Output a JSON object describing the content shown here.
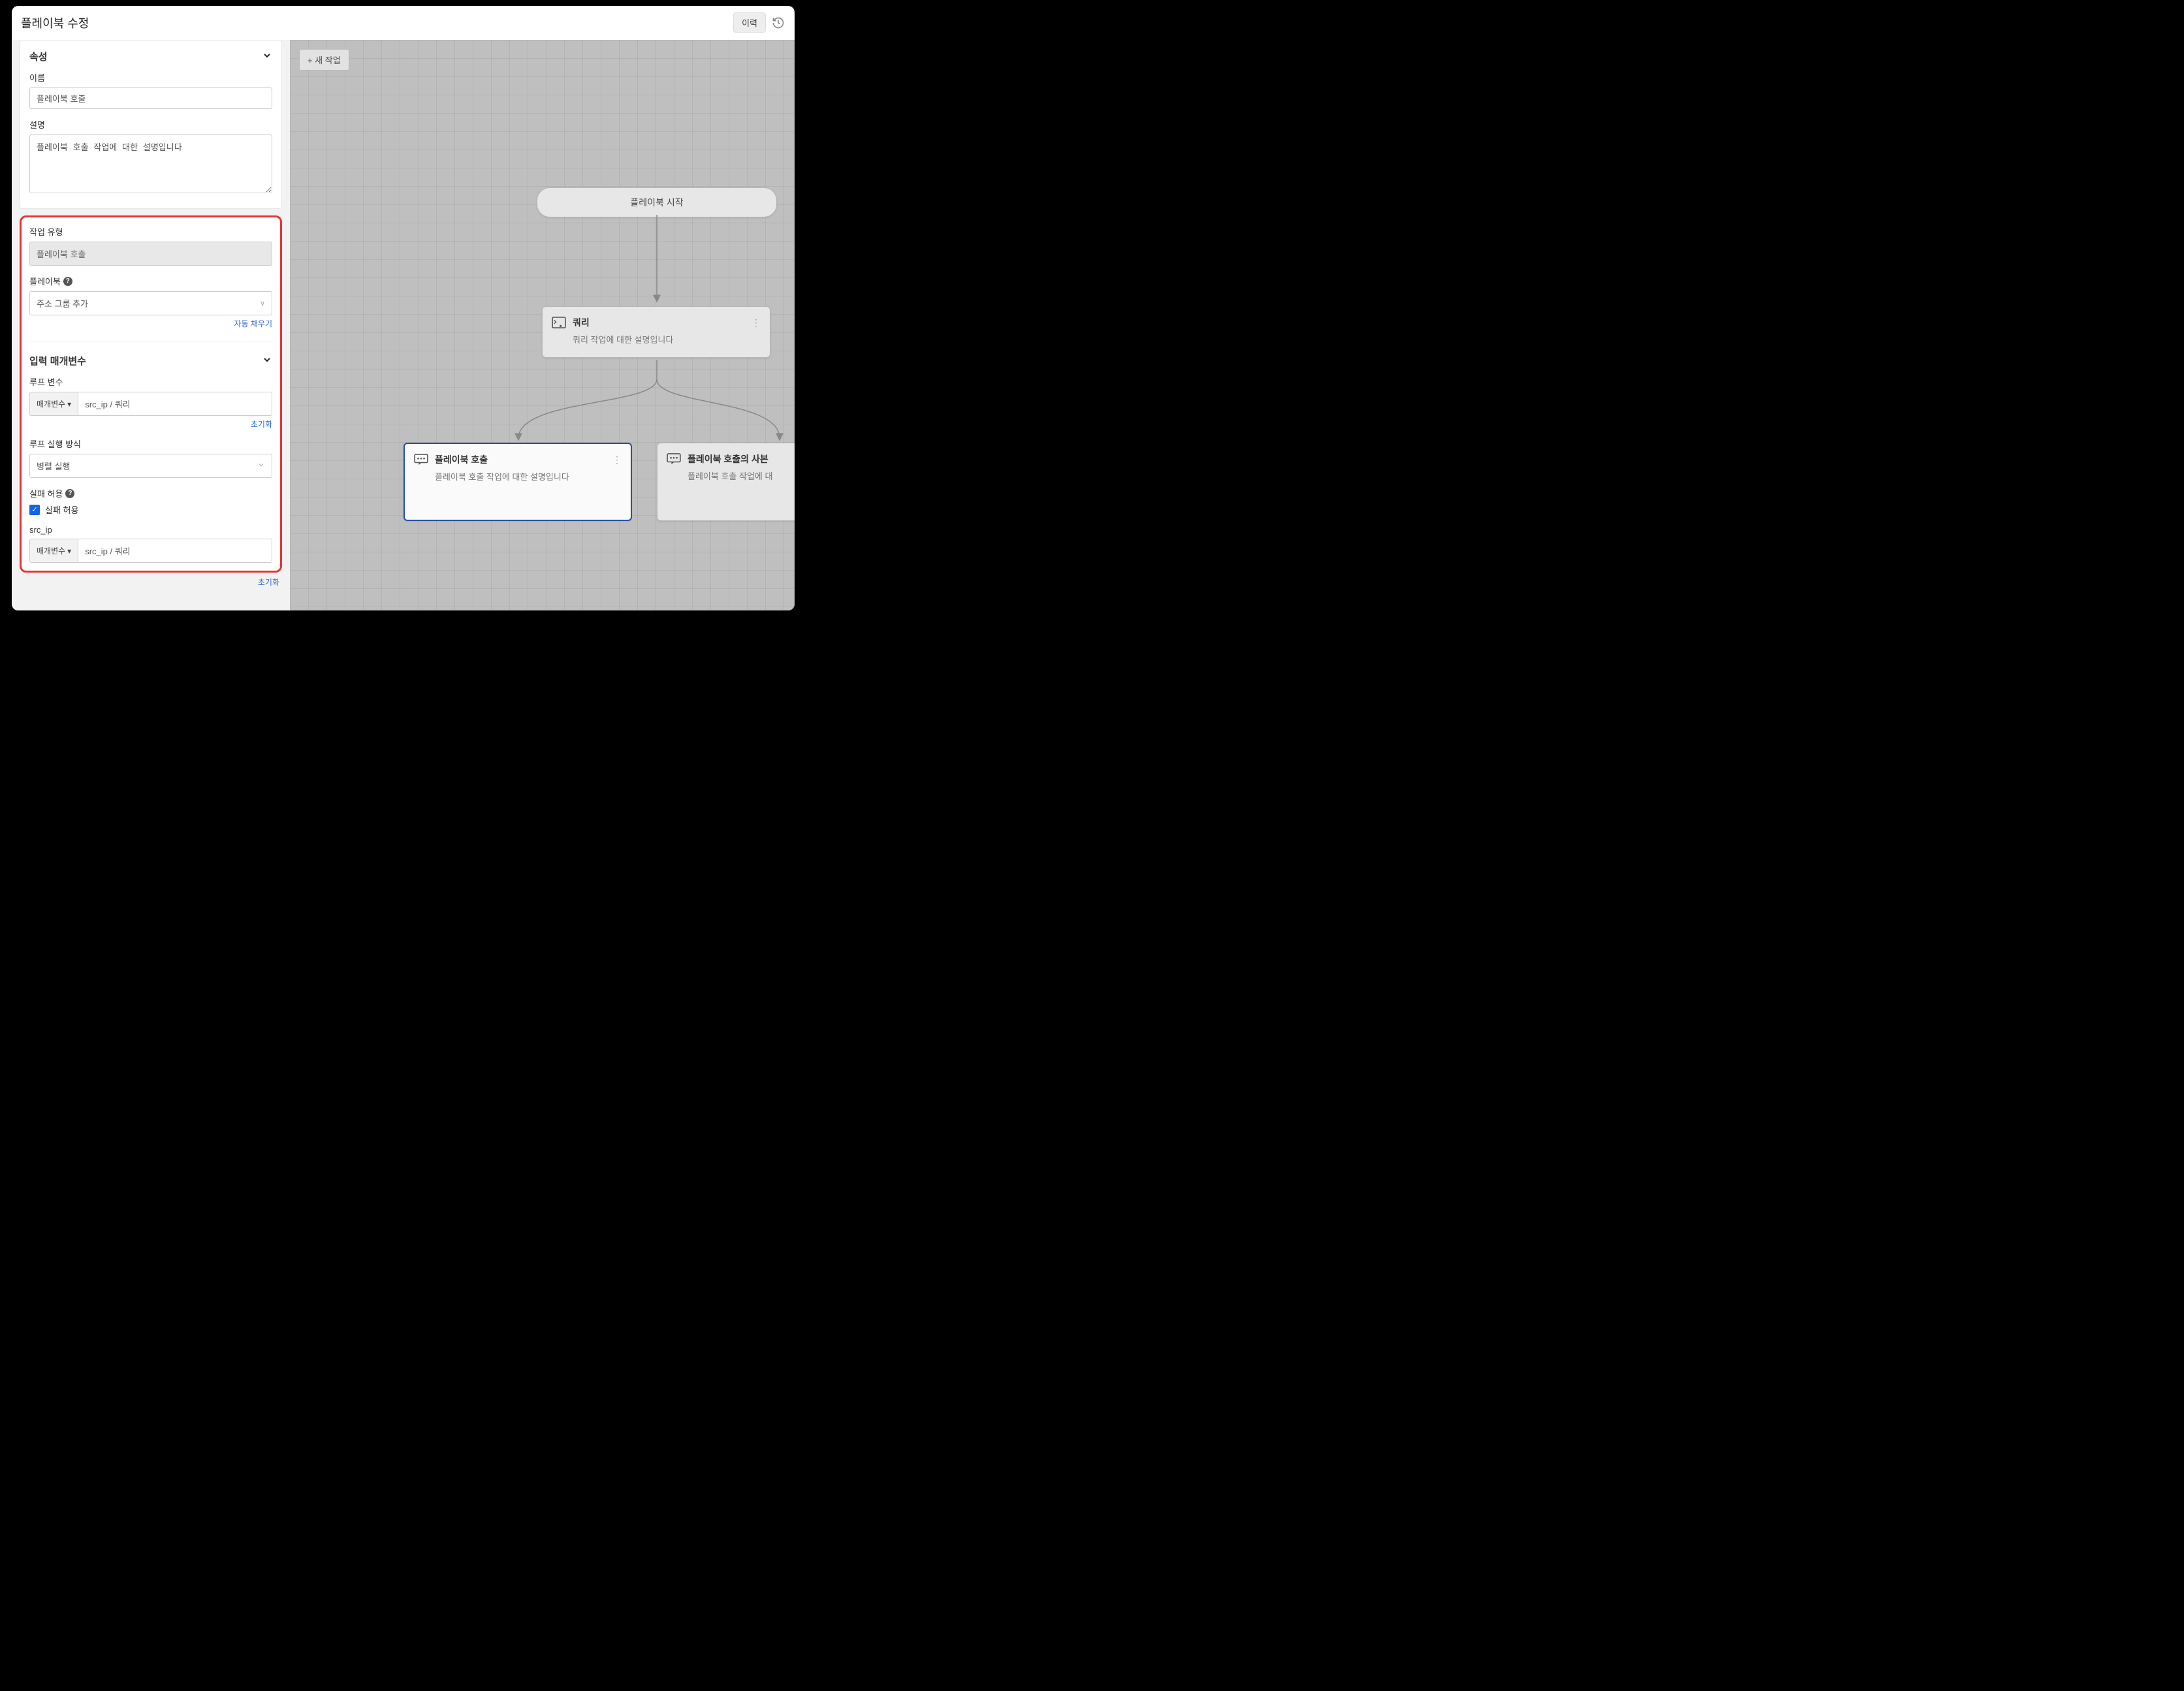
{
  "header": {
    "title": "플레이북 수정",
    "history_label": "이력"
  },
  "attributes": {
    "section_title": "속성",
    "name_label": "이름",
    "name_value": "플레이북 호출",
    "desc_label": "설명",
    "desc_value": "플레이북 호출 작업에 대한 설명입니다"
  },
  "task_type": {
    "label": "작업 유형",
    "value": "플레이북 호출",
    "playbook_label": "플레이북",
    "playbook_value": "주소 그룹 추가",
    "autofill_label": "자동 채우기"
  },
  "input_params": {
    "section_title": "입력 매개변수",
    "loop_var_label": "루프 변수",
    "param_btn": "매개변수",
    "loop_var_value": "src_ip / 쿼리",
    "reset_label": "초기화",
    "loop_exec_label": "루프 실행 방식",
    "loop_exec_value": "병렬 실행",
    "allow_fail_label": "실패 허용",
    "allow_fail_checkbox": "실패 허용",
    "src_ip_label": "src_ip",
    "src_ip_value": "src_ip / 쿼리",
    "reset_label2": "초기화"
  },
  "canvas": {
    "new_task_label": "+ 새 작업",
    "start_node": "플레이북 시작",
    "query_node": {
      "title": "쿼리",
      "desc": "쿼리 작업에 대한 설명입니다"
    },
    "call_node": {
      "title": "플레이북 호출",
      "desc": "플레이북 호출 작업에 대한 설명입니다"
    },
    "copy_node": {
      "title": "플레이북 호출의 사본",
      "desc": "플레이북 호출 작업에 대"
    }
  }
}
